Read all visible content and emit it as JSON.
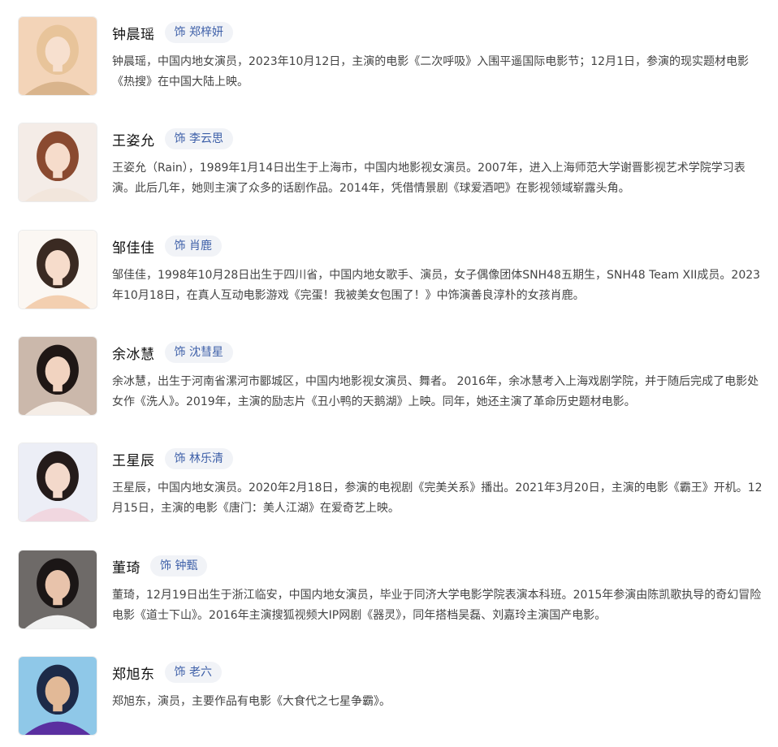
{
  "cast": [
    {
      "name": "钟晨瑶",
      "role": "饰 郑梓妍",
      "bio": "钟晨瑶，中国内地女演员，2023年10月12日，主演的电影《二次呼吸》入围平遥国际电影节；12月1日，参演的现实题材电影《热搜》在中国大陆上映。",
      "avatar": {
        "bg": "#f3d4b8",
        "hair": "#e8c49a",
        "skin": "#f7e0cf",
        "cloth": "#d9b48c"
      }
    },
    {
      "name": "王姿允",
      "role": "饰 李云思",
      "bio": "王姿允（Rain），1989年1月14日出生于上海市，中国内地影视女演员。2007年，进入上海师范大学谢晋影视艺术学院学习表演。此后几年，她则主演了众多的话剧作品。2014年，凭借情景剧《球爱酒吧》在影视领域崭露头角。",
      "avatar": {
        "bg": "#f4ece7",
        "hair": "#8a4a30",
        "skin": "#f6dccb",
        "cloth": "#f2e6dc"
      }
    },
    {
      "name": "邹佳佳",
      "role": "饰 肖鹿",
      "bio": "邹佳佳，1998年10月28日出生于四川省，中国内地女歌手、演员，女子偶像团体SNH48五期生，SNH48 Team XII成员。2023年10月18日，在真人互动电影游戏《完蛋！我被美女包围了！》中饰演善良淳朴的女孩肖鹿。",
      "avatar": {
        "bg": "#fbf7f3",
        "hair": "#3a2a22",
        "skin": "#f6dccb",
        "cloth": "#f3cfb0"
      }
    },
    {
      "name": "余冰慧",
      "role": "饰 沈彗星",
      "bio": "余冰慧，出生于河南省漯河市郾城区，中国内地影视女演员、舞者。 2016年，余冰慧考入上海戏剧学院，并于随后完成了电影处女作《洗人》。2019年，主演的励志片《丑小鸭的天鹅湖》上映。同年，她还主演了革命历史题材电影。",
      "avatar": {
        "bg": "#cbb8ab",
        "hair": "#1f1715",
        "skin": "#f1d3c0",
        "cloth": "#f5ede6"
      }
    },
    {
      "name": "王星辰",
      "role": "饰 林乐清",
      "bio": "王星辰，中国内地女演员。2020年2月18日，参演的电视剧《完美关系》播出。2021年3月20日，主演的电影《霸王》开机。12月15日，主演的电影《唐门：美人江湖》在爱奇艺上映。",
      "avatar": {
        "bg": "#eceef6",
        "hair": "#241b1a",
        "skin": "#f3d9cb",
        "cloth": "#f1d7e0"
      }
    },
    {
      "name": "董琦",
      "role": "饰 钟甄",
      "bio": "董琦，12月19日出生于浙江临安，中国内地女演员，毕业于同济大学电影学院表演本科班。2015年参演由陈凯歌执导的奇幻冒险电影《道士下山》。2016年主演搜狐视频大IP网剧《器灵》，同年搭档吴磊、刘嘉玲主演国产电影。",
      "avatar": {
        "bg": "#6e6a68",
        "hair": "#1b1616",
        "skin": "#e8c3ab",
        "cloth": "#f2f2f2"
      }
    },
    {
      "name": "郑旭东",
      "role": "饰 老六",
      "bio": "郑旭东，演员，主要作品有电影《大食代之七星争霸》。",
      "avatar": {
        "bg": "#8fc8e8",
        "hair": "#1d2a48",
        "skin": "#e2b997",
        "cloth": "#5a2fa0"
      }
    }
  ]
}
